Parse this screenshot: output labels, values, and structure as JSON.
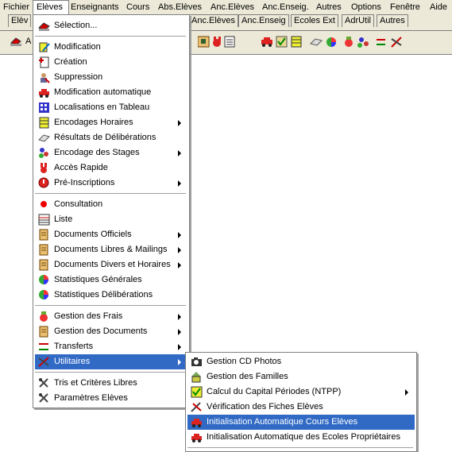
{
  "menubar": {
    "items": [
      "Fichier",
      "Elèves",
      "Enseignants",
      "Cours",
      "Abs.Elèves",
      "Anc.Elèves",
      "Anc.Enseig.",
      "Autres",
      "Options",
      "Fenêtre",
      "Aide"
    ]
  },
  "toolbar": {
    "tabs": [
      "Elèv",
      "Anc.Elèves",
      "Anc.Enseig",
      "Ecoles Ext",
      "AdrUtil",
      "Autres"
    ],
    "partial_button_label": "A"
  },
  "eleves_menu": {
    "items": [
      {
        "label": "Sélection...",
        "icon": "selection-icon",
        "submenu": false
      },
      {
        "label": "Modification",
        "icon": "pencil-icon",
        "submenu": false
      },
      {
        "label": "Création",
        "icon": "new-document-icon",
        "submenu": false
      },
      {
        "label": "Suppression",
        "icon": "user-delete-icon",
        "submenu": false
      },
      {
        "label": "Modification automatique",
        "icon": "red-car-icon",
        "submenu": false
      },
      {
        "label": "Localisations en Tableau",
        "icon": "table-grid-icon",
        "submenu": false
      },
      {
        "label": "Encodages Horaires",
        "icon": "schedule-icon",
        "submenu": true
      },
      {
        "label": "Résultats de Délibérations",
        "icon": "eraser-icon",
        "submenu": false
      },
      {
        "label": "Encodage des Stages",
        "icon": "stages-icon",
        "submenu": true
      },
      {
        "label": "Accès Rapide",
        "icon": "rabbit-icon",
        "submenu": false
      },
      {
        "label": "Pré-Inscriptions",
        "icon": "preinscription-icon",
        "submenu": true
      },
      {
        "label": "Consultation",
        "icon": "red-dot-icon",
        "submenu": false
      },
      {
        "label": "Liste",
        "icon": "list-icon",
        "submenu": false
      },
      {
        "label": "Documents Officiels",
        "icon": "document-icon",
        "submenu": true
      },
      {
        "label": "Documents Libres  & Mailings",
        "icon": "document-icon",
        "submenu": true
      },
      {
        "label": "Documents Divers et Horaires",
        "icon": "document-icon",
        "submenu": true
      },
      {
        "label": "Statistiques Générales",
        "icon": "stats-icon",
        "submenu": false
      },
      {
        "label": "Statistiques Délibérations",
        "icon": "stats-icon",
        "submenu": false
      },
      {
        "label": "Gestion des Frais",
        "icon": "money-bag-icon",
        "submenu": true
      },
      {
        "label": "Gestion des Documents",
        "icon": "document-icon",
        "submenu": true
      },
      {
        "label": "Transferts",
        "icon": "transfer-arrows-icon",
        "submenu": true
      },
      {
        "label": "Utilitaires",
        "icon": "tools-icon",
        "submenu": true
      },
      {
        "label": "Tris et Critères Libres",
        "icon": "sort-icon",
        "submenu": false
      },
      {
        "label": "Paramètres Elèves",
        "icon": "sort-icon",
        "submenu": false
      }
    ]
  },
  "utilitaires_menu": {
    "items": [
      {
        "label": "Gestion CD Photos",
        "icon": "camera-icon",
        "submenu": false
      },
      {
        "label": "Gestion des Familles",
        "icon": "house-icon",
        "submenu": false
      },
      {
        "label": "Calcul du Capital Périodes (NTPP)",
        "icon": "calc-icon",
        "submenu": true
      },
      {
        "label": "Vérification des Fiches Elèves",
        "icon": "check-tools-icon",
        "submenu": false
      },
      {
        "label": "Initialisation Automatique Cours Elèves",
        "icon": "red-car-icon",
        "submenu": false
      },
      {
        "label": "Initialisation Automatique des Ecoles Propriétaires",
        "icon": "red-car-icon",
        "submenu": false
      }
    ]
  },
  "colors": {
    "highlight": "#316ac5",
    "chrome": "#ece9d8"
  }
}
